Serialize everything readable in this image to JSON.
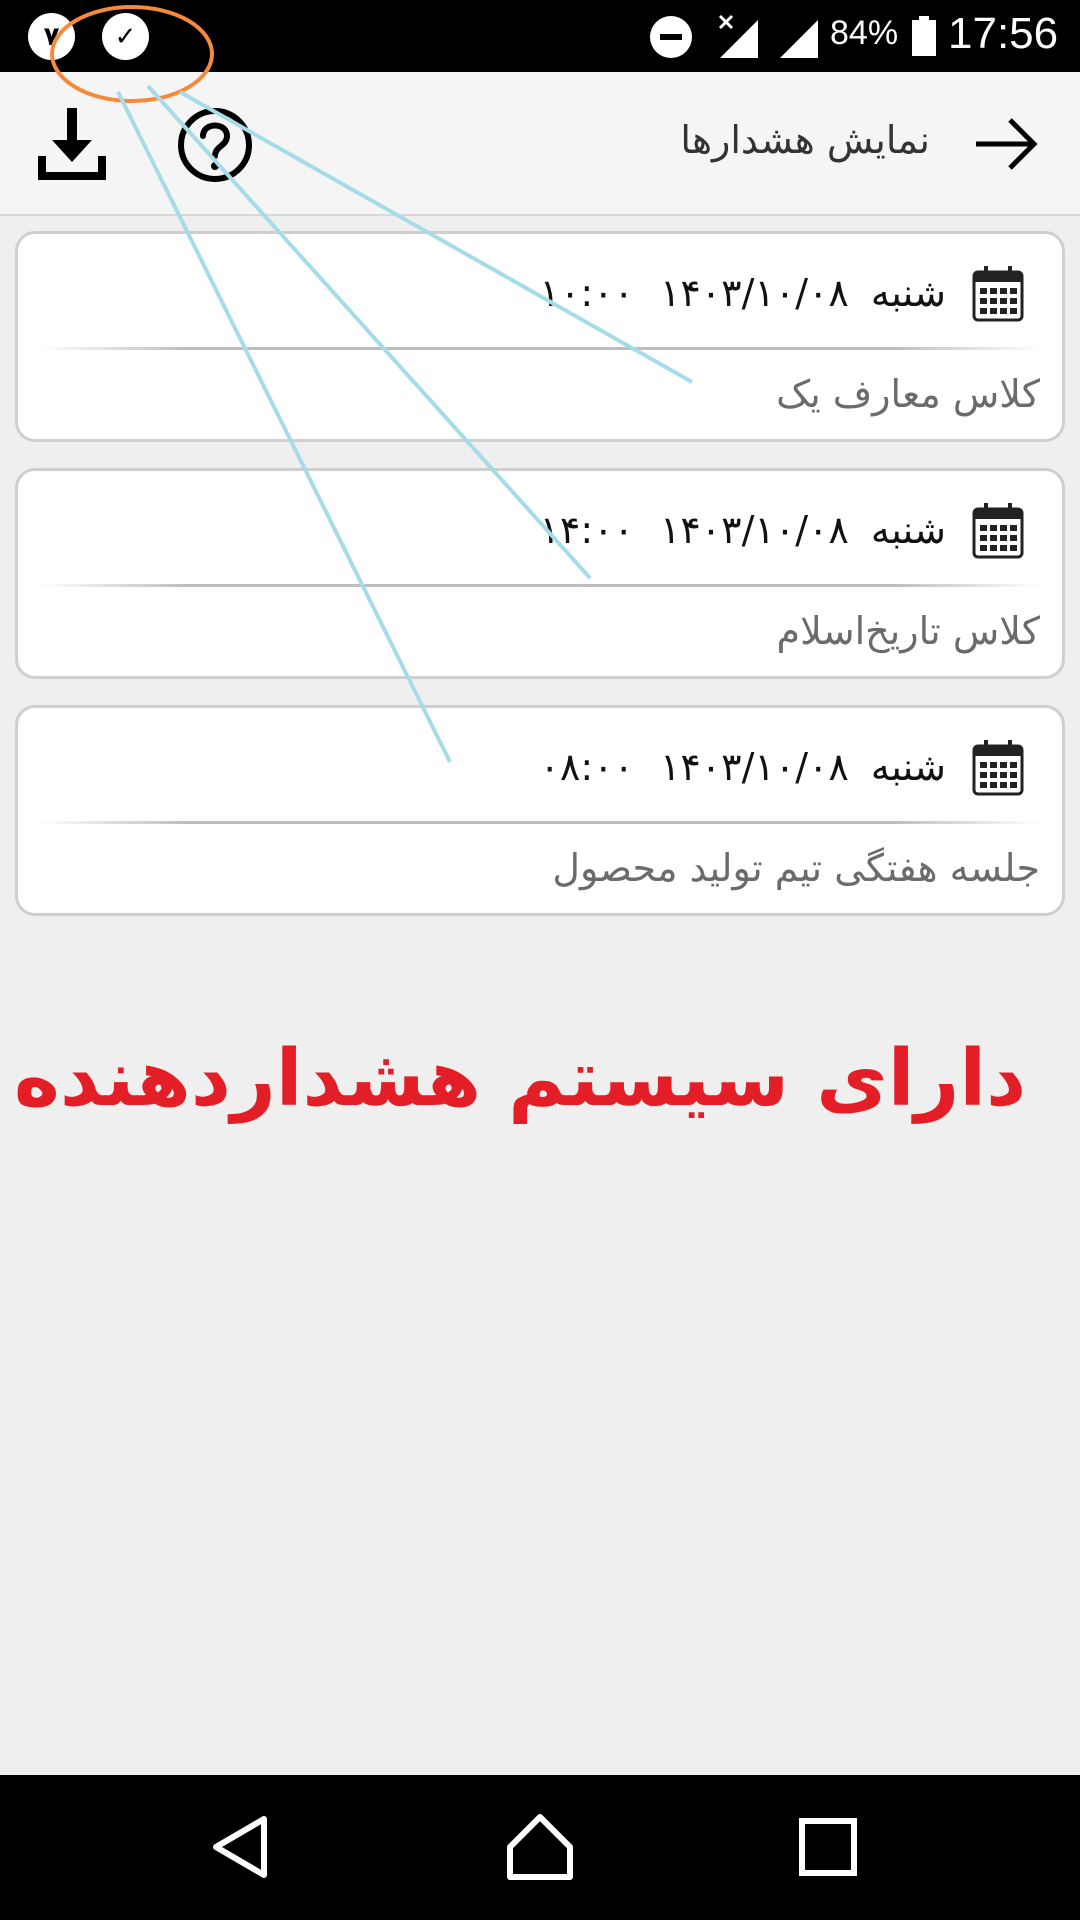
{
  "status_bar": {
    "notification_badge": "۷",
    "check_glyph": "✓",
    "battery": "84%",
    "time": "17:56",
    "icons": [
      "do-not-disturb-icon",
      "signal-no-sim-icon",
      "signal-icon",
      "battery-icon"
    ]
  },
  "toolbar": {
    "title": "نمایش هشدارها",
    "icons": [
      "back-arrow-icon",
      "help-icon",
      "download-icon"
    ]
  },
  "alerts": [
    {
      "day": "شنبه",
      "date": "۱۴۰۳/۱۰/۰۸",
      "time": "۱۰:۰۰",
      "title": "کلاس معارف یک"
    },
    {
      "day": "شنبه",
      "date": "۱۴۰۳/۱۰/۰۸",
      "time": "۱۴:۰۰",
      "title": "کلاس تاریخ‌اسلام"
    },
    {
      "day": "شنبه",
      "date": "۱۴۰۳/۱۰/۰۸",
      "time": "۰۸:۰۰",
      "title": "جلسه هفتگی تیم تولید محصول"
    }
  ],
  "headline": "دارای سیستم هشداردهنده",
  "colors": {
    "headline": "#e41e26",
    "annotation_circle": "#f58a3c",
    "annotation_lines": "#a6dbe8",
    "background": "#efefef"
  },
  "nav_bar": {
    "icons": [
      "nav-back-icon",
      "nav-home-icon",
      "nav-recents-icon"
    ]
  }
}
